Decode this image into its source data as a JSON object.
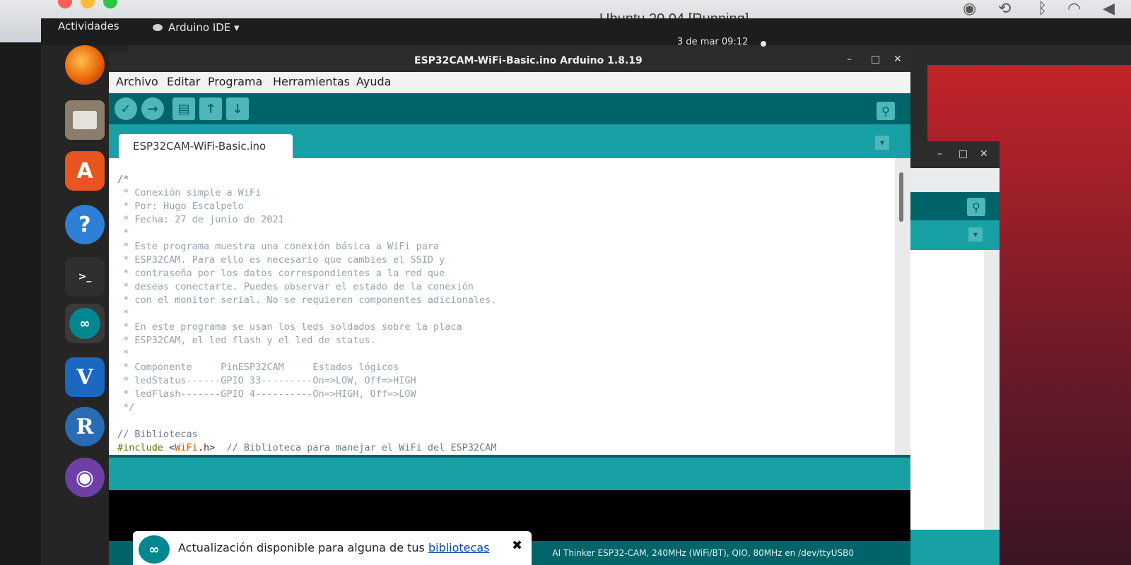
{
  "host": {
    "title": "Ubuntu 20.04 [Running]"
  },
  "gnome": {
    "activities": "Actividades",
    "app_menu": "Arduino IDE ▾",
    "clock": "3 de mar  09:12"
  },
  "dock": {
    "items": [
      "firefox",
      "files",
      "software",
      "help",
      "terminal",
      "arduino",
      "vnc",
      "r",
      "github"
    ]
  },
  "window": {
    "title": "ESP32CAM-WiFi-Basic.ino Arduino 1.8.19",
    "minimize": "–",
    "maximize": "□",
    "close": "✕",
    "menu": [
      "Archivo",
      "Editar",
      "Programa",
      "Herramientas",
      "Ayuda"
    ],
    "toolbar": {
      "verify": "✓",
      "upload": "→",
      "new": "▤",
      "open": "↑",
      "save": "↓",
      "serial": "⚲"
    },
    "tab": "ESP32CAM-WiFi-Basic.ino",
    "tab_menu": "▾"
  },
  "code": {
    "lines": [
      "/*",
      " * Conexión simple a WiFi",
      " * Por: Hugo Escalpelo",
      " * Fecha: 27 de junio de 2021",
      " *",
      " * Este programa muestra una conexión básica a WiFi para",
      " * ESP32CAM. Para ello es necesario que cambies el SSID y",
      " * contraseña por los datos correspondientes a la red que",
      " * deseas conectarte. Puedes observar el estado de la conexión",
      " * con el monitor serial. No se requieren componentes adicionales.",
      " *",
      " * En este programa se usan los leds soldados sobre la placa",
      " * ESP32CAM, el led flash y el led de status.",
      " *",
      " * Componente     PinESP32CAM     Estados lógicos",
      " * ledStatus------GPIO 33---------On=>LOW, Off=>HIGH",
      " * ledFlash-------GPIO 4----------On=>HIGH, Off=>LOW",
      " */",
      "",
      "// Bibliotecas"
    ],
    "include_directive": "#include",
    "include_open": " <",
    "include_lib": "WiFi",
    "include_close": ".h>",
    "include_comment": "  // Biblioteca para manejar el WiFi del ESP32CAM"
  },
  "board_info": "AI Thinker ESP32-CAM, 240MHz (WiFi/BT), QIO, 80MHz en /dev/ttyUSB0",
  "notification": {
    "text": "Actualización disponible para alguna de tus ",
    "link": "bibliotecas",
    "close": "✖"
  },
  "colors": {
    "toolbar": "#006468",
    "tabs": "#17a1a5",
    "accent": "#e95420"
  }
}
